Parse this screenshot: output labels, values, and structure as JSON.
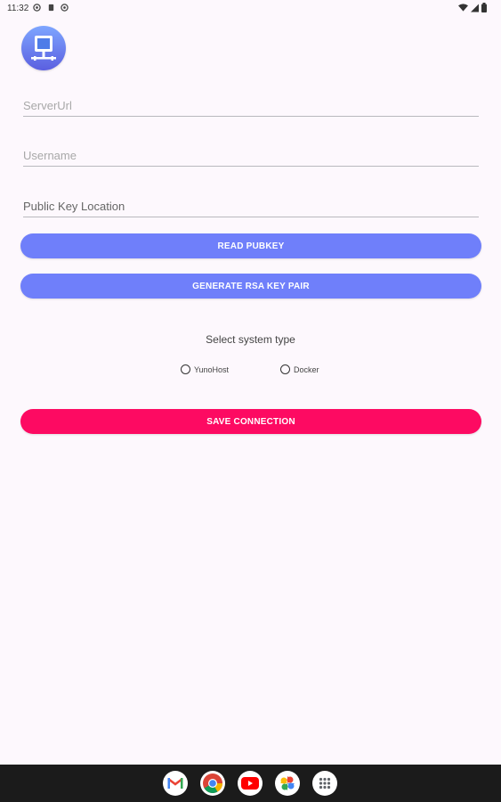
{
  "status_bar": {
    "time": "11:32"
  },
  "app": {
    "icon_name": "monitor-network-icon"
  },
  "form": {
    "server_url": {
      "placeholder": "ServerUrl",
      "value": ""
    },
    "username": {
      "placeholder": "Username",
      "value": ""
    },
    "public_key_location": {
      "placeholder": "Public Key Location",
      "value": ""
    }
  },
  "buttons": {
    "read_pubkey": "READ PUBKEY",
    "generate_rsa": "GENERATE RSA KEY PAIR",
    "save_connection": "SAVE CONNECTION"
  },
  "system_type": {
    "label": "Select system type",
    "options": [
      {
        "label": "YunoHost",
        "selected": false
      },
      {
        "label": "Docker",
        "selected": false
      }
    ]
  },
  "dock": {
    "apps": [
      "gmail-icon",
      "chrome-icon",
      "youtube-icon",
      "photos-icon",
      "app-drawer-icon"
    ]
  },
  "colors": {
    "primary_button": "#6f7ffa",
    "accent_button": "#fd0a62",
    "background": "#fdf8fd"
  }
}
